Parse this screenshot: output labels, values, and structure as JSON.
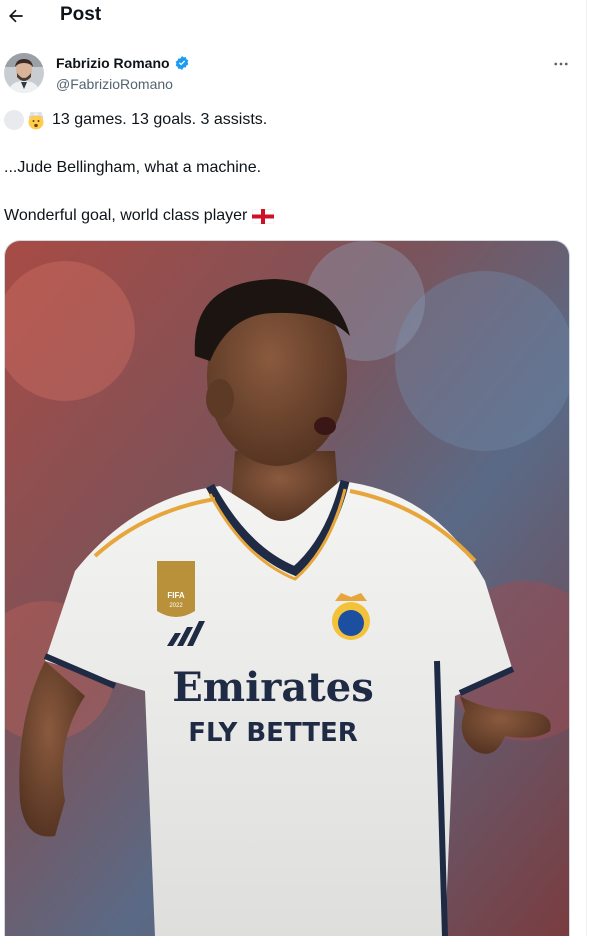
{
  "header": {
    "title": "Post",
    "back_icon": "arrow-left-icon"
  },
  "author": {
    "name": "Fabrizio Romano",
    "handle": "@FabrizioRomano",
    "verified": true,
    "verified_color": "#1d9bf0",
    "more_icon": "more-horizontal-icon"
  },
  "post": {
    "line1_text": "13 games. 13 goals. 3 assists.",
    "line2_text": "...Jude Bellingham, what a machine.",
    "line3_text": "Wonderful goal, world class player",
    "emoji": [
      "blank-emoji",
      "exploding-head-emoji"
    ],
    "flag": "england-flag"
  },
  "media": {
    "type": "photo",
    "shirt_sponsor": "Emirates",
    "shirt_tagline": "FLY BETTER",
    "badge_text": "FIFA",
    "badge_year": "2022"
  },
  "colors": {
    "text": "#0f1419",
    "secondary": "#536471",
    "accent": "#1d9bf0"
  }
}
